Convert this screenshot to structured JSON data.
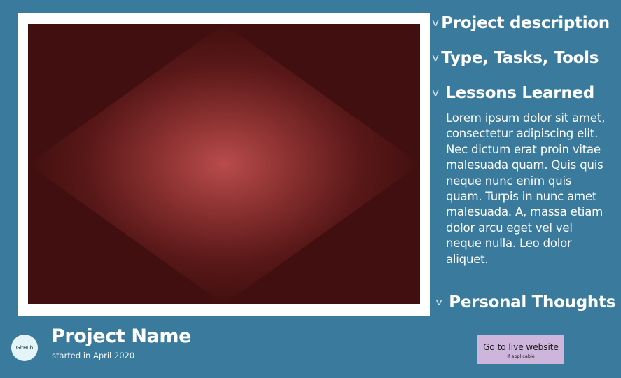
{
  "preview": {
    "frame_color": "#ffffff",
    "fill_color": "#420f10",
    "glow_color": "#b84c4b"
  },
  "sections": {
    "project_description": {
      "label": "Project description",
      "icon": "chevron-down-icon"
    },
    "type_tasks_tools": {
      "label": "Type, Tasks, Tools",
      "icon": "chevron-down-icon"
    },
    "lessons_learned": {
      "label": "Lessons Learned",
      "icon": "chevron-down-icon",
      "body": "Lorem ipsum dolor sit amet, consectetur adipiscing elit. Nec dictum erat proin vitae malesuada quam. Quis quis neque nunc enim quis quam. Turpis in nunc amet malesuada. A, massa etiam dolor arcu eget vel vel neque nulla. Leo dolor aliquet."
    },
    "personal_thoughts": {
      "label": "Personal Thoughts",
      "icon": "chevron-down-icon"
    }
  },
  "chevron_glyph": "v",
  "footer": {
    "github_label": "GitHub",
    "project_name": "Project Name",
    "started": "started in April 2020",
    "live_button": {
      "label": "Go to live website",
      "sublabel": "if applicable",
      "color": "#cdb5db"
    }
  },
  "colors": {
    "background": "#3a7a9d",
    "text": "#ffffff",
    "github_circle": "#e4f4f8"
  }
}
